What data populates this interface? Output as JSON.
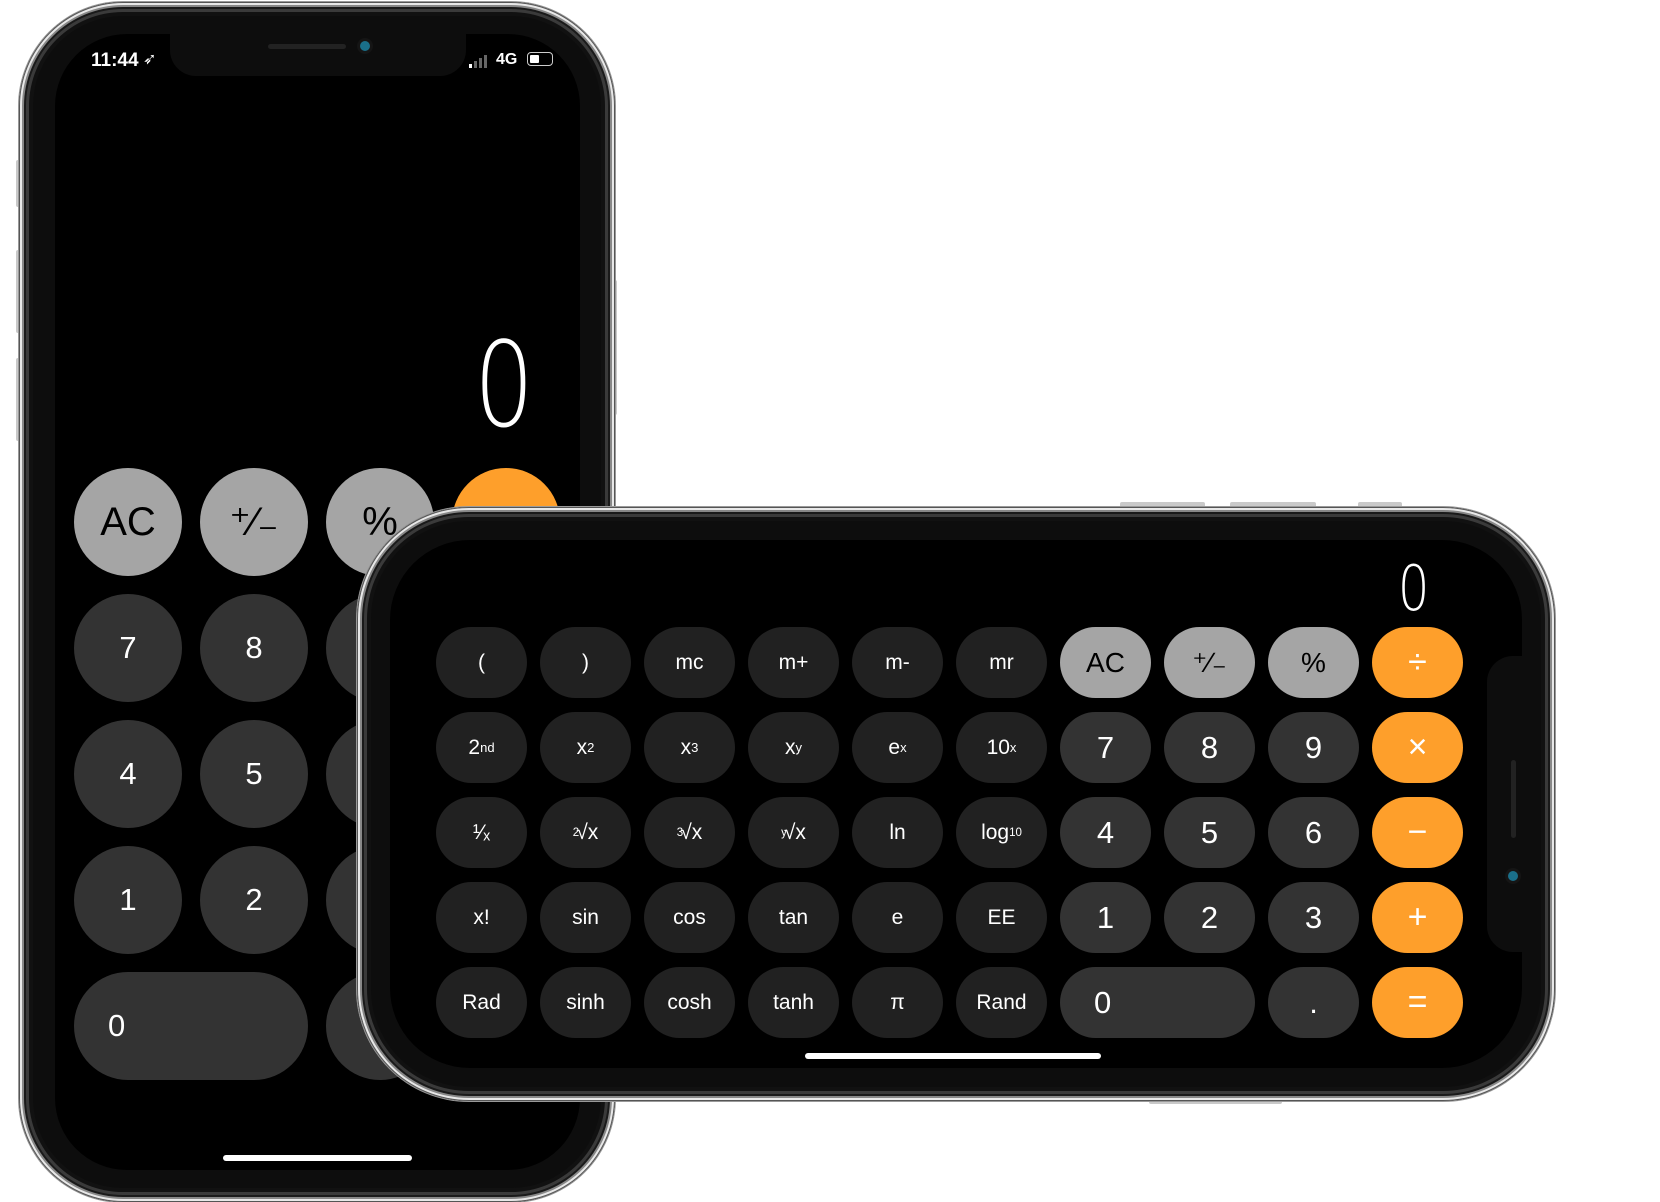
{
  "colors": {
    "orange": "#fe9f2b",
    "light_grey": "#a5a5a5",
    "dark_grey": "#333333",
    "sci_grey": "#212121"
  },
  "portrait": {
    "status_bar": {
      "time": "11:44",
      "location_icon": "location-arrow-icon",
      "network": "4G",
      "signal_icon": "signal-bars-icon",
      "battery_icon": "battery-icon"
    },
    "display": "0",
    "keys": [
      {
        "label": "AC",
        "type": "fn"
      },
      {
        "label": "+/-",
        "main": "⁺∕₋",
        "type": "fn"
      },
      {
        "label": "%",
        "type": "fn"
      },
      {
        "label": "",
        "type": "op"
      },
      {
        "label": "7",
        "type": "num"
      },
      {
        "label": "8",
        "type": "num"
      },
      {
        "label": "",
        "type": "num"
      },
      {
        "label": "",
        "type": "op"
      },
      {
        "label": "4",
        "type": "num"
      },
      {
        "label": "5",
        "type": "num"
      },
      {
        "label": "",
        "type": "num"
      },
      {
        "label": "",
        "type": "op"
      },
      {
        "label": "1",
        "type": "num"
      },
      {
        "label": "2",
        "type": "num"
      },
      {
        "label": "",
        "type": "num"
      },
      {
        "label": "",
        "type": "op"
      },
      {
        "label": "0",
        "type": "num",
        "wide": true
      },
      {
        "label": "",
        "type": "num"
      },
      {
        "label": "",
        "type": "op"
      }
    ]
  },
  "landscape": {
    "display": "0",
    "keys": [
      {
        "label": "(",
        "type": "sci"
      },
      {
        "label": ")",
        "type": "sci"
      },
      {
        "label": "mc",
        "type": "sci"
      },
      {
        "label": "m+",
        "type": "sci"
      },
      {
        "label": "m-",
        "type": "sci"
      },
      {
        "label": "mr",
        "type": "sci"
      },
      {
        "label": "AC",
        "type": "fn"
      },
      {
        "label": "⁺∕₋",
        "type": "fn"
      },
      {
        "label": "%",
        "type": "fn"
      },
      {
        "label": "÷",
        "type": "op"
      },
      {
        "label": "2",
        "sup": "nd",
        "type": "sci"
      },
      {
        "label": "x",
        "sup": "2",
        "type": "sci"
      },
      {
        "label": "x",
        "sup": "3",
        "type": "sci"
      },
      {
        "label": "x",
        "sup": "y",
        "type": "sci"
      },
      {
        "label": "e",
        "sup": "x",
        "type": "sci"
      },
      {
        "label": "10",
        "sup": "x",
        "type": "sci"
      },
      {
        "label": "7",
        "type": "num"
      },
      {
        "label": "8",
        "type": "num"
      },
      {
        "label": "9",
        "type": "num"
      },
      {
        "label": "×",
        "type": "op"
      },
      {
        "label": "¹∕ₓ",
        "type": "sci"
      },
      {
        "pre": "2",
        "label": "√x",
        "type": "sci"
      },
      {
        "pre": "3",
        "label": "√x",
        "type": "sci"
      },
      {
        "pre": "y",
        "label": "√x",
        "type": "sci"
      },
      {
        "label": "ln",
        "type": "sci"
      },
      {
        "label": "log",
        "sub": "10",
        "type": "sci"
      },
      {
        "label": "4",
        "type": "num"
      },
      {
        "label": "5",
        "type": "num"
      },
      {
        "label": "6",
        "type": "num"
      },
      {
        "label": "−",
        "type": "op"
      },
      {
        "label": "x!",
        "type": "sci"
      },
      {
        "label": "sin",
        "type": "sci"
      },
      {
        "label": "cos",
        "type": "sci"
      },
      {
        "label": "tan",
        "type": "sci"
      },
      {
        "label": "e",
        "type": "sci"
      },
      {
        "label": "EE",
        "type": "sci"
      },
      {
        "label": "1",
        "type": "num"
      },
      {
        "label": "2",
        "type": "num"
      },
      {
        "label": "3",
        "type": "num"
      },
      {
        "label": "+",
        "type": "op"
      },
      {
        "label": "Rad",
        "type": "sci"
      },
      {
        "label": "sinh",
        "type": "sci"
      },
      {
        "label": "cosh",
        "type": "sci"
      },
      {
        "label": "tanh",
        "type": "sci"
      },
      {
        "label": "π",
        "type": "sci"
      },
      {
        "label": "Rand",
        "type": "sci"
      },
      {
        "label": "0",
        "type": "num",
        "wide": true
      },
      {
        "label": ".",
        "type": "num"
      },
      {
        "label": "=",
        "type": "op"
      }
    ]
  }
}
